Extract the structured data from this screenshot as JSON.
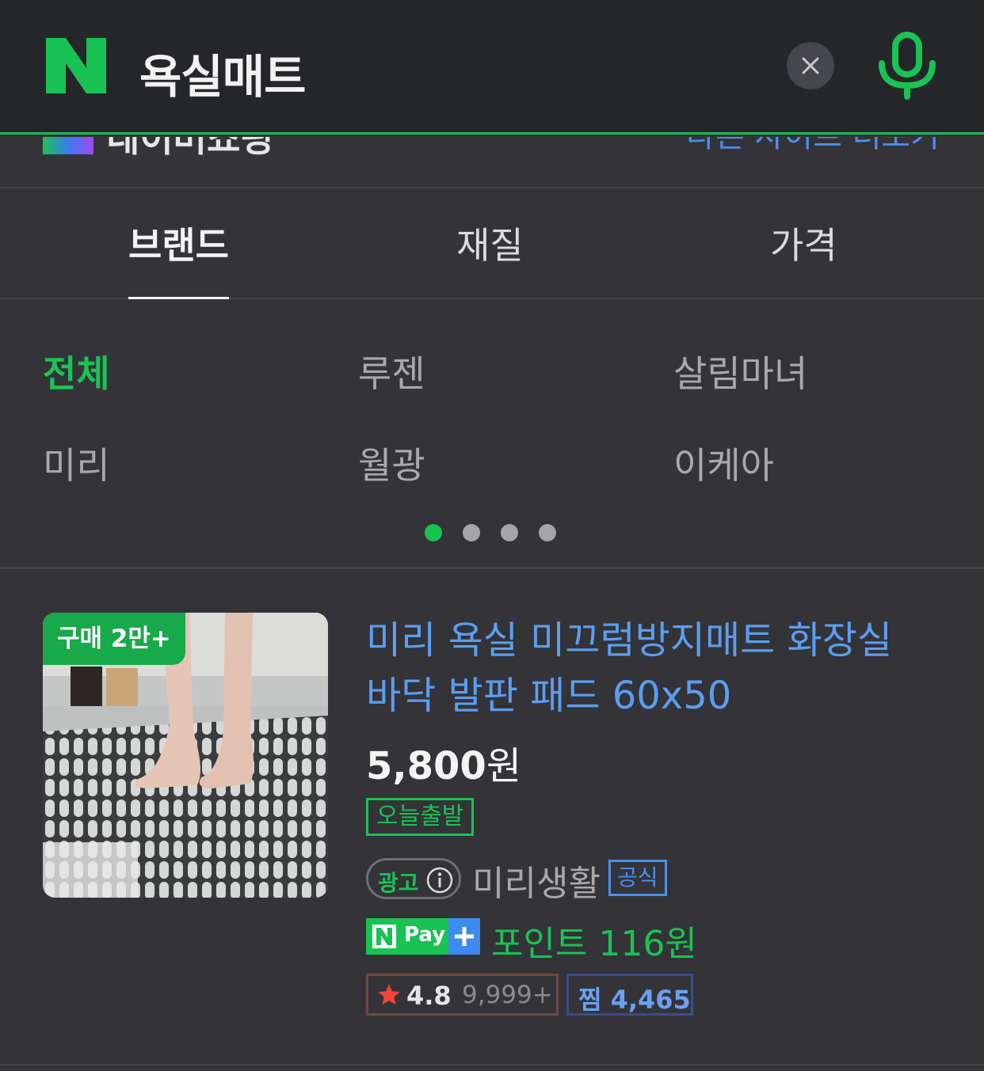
{
  "search": {
    "query": "욕실매트"
  },
  "shopping_header": {
    "title_partial": "네이버쇼핑",
    "link_partial": "다른 사이트 더보기"
  },
  "tabs": [
    {
      "label": "브랜드",
      "active": true
    },
    {
      "label": "재질",
      "active": false
    },
    {
      "label": "가격",
      "active": false
    }
  ],
  "brands": [
    {
      "label": "전체",
      "active": true
    },
    {
      "label": "루젠",
      "active": false
    },
    {
      "label": "살림마녀",
      "active": false
    },
    {
      "label": "미리",
      "active": false
    },
    {
      "label": "월광",
      "active": false
    },
    {
      "label": "이케아",
      "active": false
    }
  ],
  "pagination": {
    "pages": 4,
    "current": 1
  },
  "product": {
    "badge": "구매 2만+",
    "title_line1": "미리 욕실 미끄럼방지매트 화장실",
    "title_line2": "바닥 발판 패드 60x50",
    "price_number": "5,800",
    "price_unit": "원",
    "delivery_tag": "오늘출발",
    "ad_label": "광고",
    "seller": "미리생활",
    "official_tag": "공식",
    "npay_label": "Pay",
    "points_text": "포인트 116원",
    "rating": "4.8",
    "review_count": "9,999+",
    "zzim_text": "찜 4,465"
  },
  "colors": {
    "accent_green": "#19c353",
    "link_blue": "#5b9ef0",
    "background": "#333338",
    "topbar": "#25262a"
  },
  "icons": {
    "logo": "naver-n-logo",
    "clear": "close-icon",
    "voice": "mic-icon",
    "ad_info": "info-icon",
    "star": "star-icon"
  }
}
